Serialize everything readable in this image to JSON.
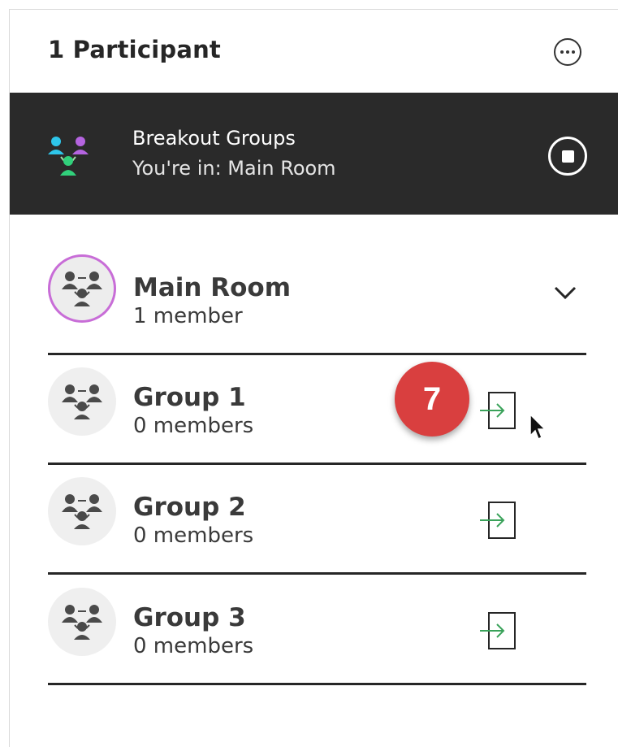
{
  "header": {
    "title": "1 Participant",
    "more_icon": "more-horizontal-icon"
  },
  "banner": {
    "title": "Breakout Groups",
    "subtitle": "You're in: Main Room",
    "icon": "breakout-groups-icon",
    "stop_icon": "stop-icon",
    "background": "#2a2a2a"
  },
  "groups": [
    {
      "name": "Main Room",
      "count": "1 member",
      "active": true,
      "icon": "group-icon",
      "action": "chevron-down-icon"
    },
    {
      "name": "Group 1",
      "count": "0 members",
      "active": false,
      "icon": "group-icon",
      "action": "join-icon"
    },
    {
      "name": "Group 2",
      "count": "0 members",
      "active": false,
      "icon": "group-icon",
      "action": "join-icon"
    },
    {
      "name": "Group 3",
      "count": "0 members",
      "active": false,
      "icon": "group-icon",
      "action": "join-icon"
    }
  ],
  "step_badge": {
    "label": "7",
    "color": "#d93f3f"
  },
  "colors": {
    "active_ring": "#c86dd7",
    "join_arrow": "#3aa25a",
    "divider": "#262626"
  }
}
